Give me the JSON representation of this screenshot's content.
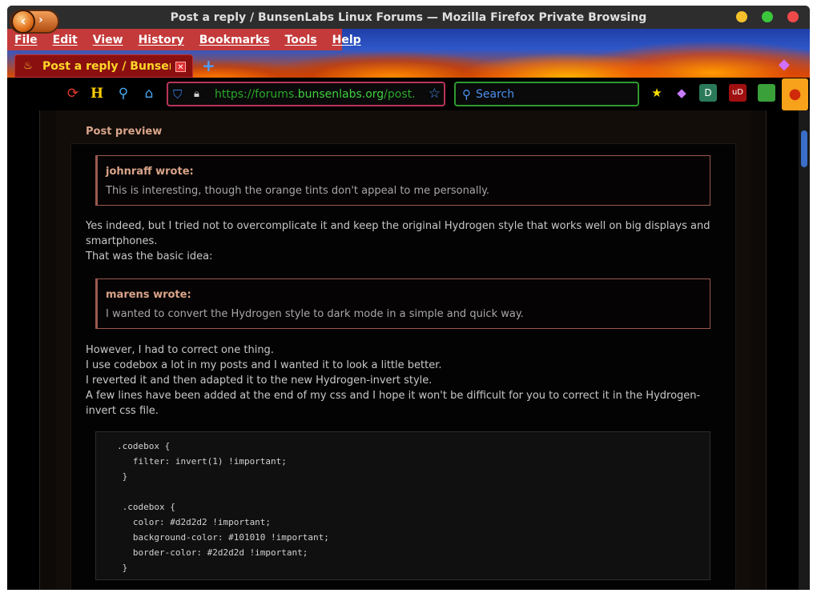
{
  "window": {
    "title": "Post a reply / BunsenLabs Linux Forums — Mozilla Firefox Private Browsing"
  },
  "menu": [
    "File",
    "Edit",
    "View",
    "History",
    "Bookmarks",
    "Tools",
    "Help"
  ],
  "tab": {
    "title": "Post a reply / BunsenLabs Linux Forums",
    "close": "✕"
  },
  "newtab": "+",
  "url": {
    "prefix": "https://forums.",
    "domain": "bunsenlabs.org",
    "path": "/post.php"
  },
  "search": {
    "placeholder": "Search"
  },
  "preview": {
    "heading": "Post preview",
    "quote1": {
      "author": "johnraff wrote:",
      "text": "This is interesting, though the orange tints don't appeal to me personally."
    },
    "para1": [
      "Yes indeed, but I tried not to overcomplicate it and keep the original Hydrogen style that works well on big displays and smartphones.",
      "That was the basic idea:"
    ],
    "quote2": {
      "author": "marens wrote:",
      "text": "I wanted to convert the Hydrogen style to dark mode in a simple and quick way."
    },
    "para2": [
      "However, I had to correct one thing.",
      "I use codebox a lot in my posts and I wanted it to look a little better.",
      "I reverted it and then adapted it to the new Hydrogen-invert style.",
      "A few lines have been added at the end of my css and I hope it won't be difficult for you to correct it in the Hydrogen-invert css file."
    ],
    "code": [
      ".codebox {",
      "   filter: invert(1) !important;",
      " }",
      "",
      " .codebox {",
      "   color: #d2d2d2 !important;",
      "   background-color: #101010 !important;",
      "   border-color: #2d2d2d !important;",
      " }"
    ]
  },
  "colors": {
    "accent": "#c43a3a",
    "quote_border": "#9a5a4e",
    "heading": "#d9a48a",
    "url_green": "#3fd03f",
    "search_blue": "#4a90ef"
  }
}
